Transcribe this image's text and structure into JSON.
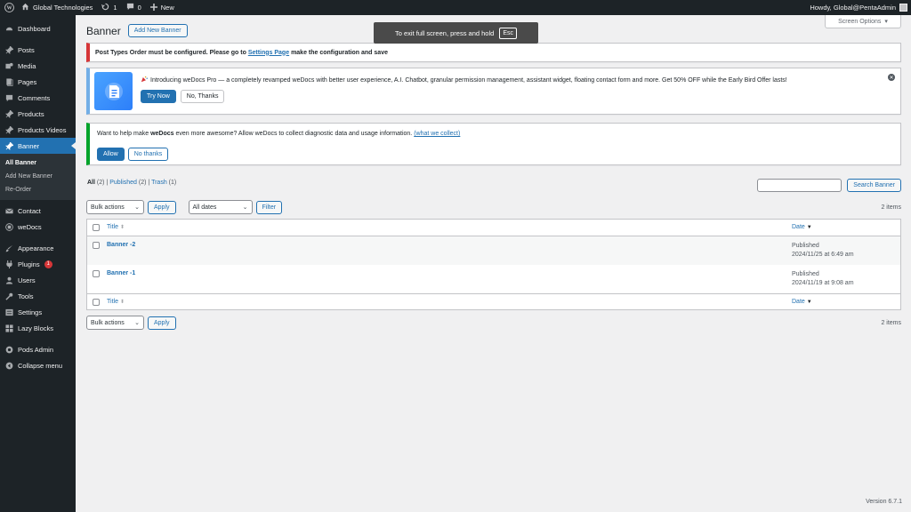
{
  "adminbar": {
    "site_name": "Global Technologies",
    "updates_count": "1",
    "comments_count": "0",
    "new_label": "New",
    "howdy": "Howdy, Global@PentaAdmin"
  },
  "fullscreen_toast": {
    "text": "To exit full screen, press and hold",
    "key": "Esc"
  },
  "sidebar": {
    "items": [
      {
        "label": "Dashboard",
        "icon": "dashboard-icon"
      },
      {
        "label": "Posts",
        "icon": "pin-icon"
      },
      {
        "label": "Media",
        "icon": "media-icon"
      },
      {
        "label": "Pages",
        "icon": "page-icon"
      },
      {
        "label": "Comments",
        "icon": "comment-icon"
      },
      {
        "label": "Products",
        "icon": "pin-icon"
      },
      {
        "label": "Products Videos",
        "icon": "pin-icon"
      },
      {
        "label": "Banner",
        "icon": "pin-icon"
      },
      {
        "label": "Contact",
        "icon": "mail-icon"
      },
      {
        "label": "weDocs",
        "icon": "docs-icon"
      },
      {
        "label": "Appearance",
        "icon": "brush-icon"
      },
      {
        "label": "Plugins",
        "icon": "plugin-icon",
        "badge": "1"
      },
      {
        "label": "Users",
        "icon": "user-icon"
      },
      {
        "label": "Tools",
        "icon": "wrench-icon"
      },
      {
        "label": "Settings",
        "icon": "settings-icon"
      },
      {
        "label": "Lazy Blocks",
        "icon": "block-icon"
      },
      {
        "label": "Pods Admin",
        "icon": "pods-icon"
      },
      {
        "label": "Collapse menu",
        "icon": "collapse-icon"
      }
    ],
    "submenu": [
      "All Banner",
      "Add New Banner",
      "Re-Order"
    ]
  },
  "screen_options": "Screen Options",
  "page": {
    "title": "Banner",
    "add_new": "Add New Banner"
  },
  "notices": {
    "error": {
      "text_before": "Post Types Order must be configured. Please go to",
      "link": "Settings Page",
      "text_after": "make the configuration and save"
    },
    "promo": {
      "text": "Introducing weDocs Pro — a completely revamped weDocs with better user experience, A.I. Chatbot, granular permission management, assistant widget, floating contact form and more. Get 50% OFF while the Early Bird Offer lasts!",
      "try_now": "Try Now",
      "no_thanks": "No, Thanks"
    },
    "optin": {
      "text_before": "Want to help make",
      "brand": "weDocs",
      "text_after": "even more awesome? Allow weDocs to collect diagnostic data and usage information.",
      "link": "(what we collect)",
      "allow": "Allow",
      "no_thanks": "No thanks"
    }
  },
  "filters": {
    "all": "All",
    "all_count": "(2)",
    "published": "Published",
    "published_count": "(2)",
    "trash": "Trash",
    "trash_count": "(1)",
    "sep": "|"
  },
  "search": {
    "button": "Search Banner",
    "value": ""
  },
  "tablenav": {
    "bulk_actions": "Bulk actions",
    "apply": "Apply",
    "dates": "All dates",
    "filter": "Filter",
    "items_count": "2 items"
  },
  "table": {
    "columns": {
      "title": "Title",
      "date": "Date"
    },
    "rows": [
      {
        "title": "Banner -2",
        "status": "Published",
        "date": "2024/11/25 at 6:49 am"
      },
      {
        "title": "Banner -1",
        "status": "Published",
        "date": "2024/11/19 at 9:08 am"
      }
    ]
  },
  "footer": {
    "version": "Version 6.7.1"
  }
}
